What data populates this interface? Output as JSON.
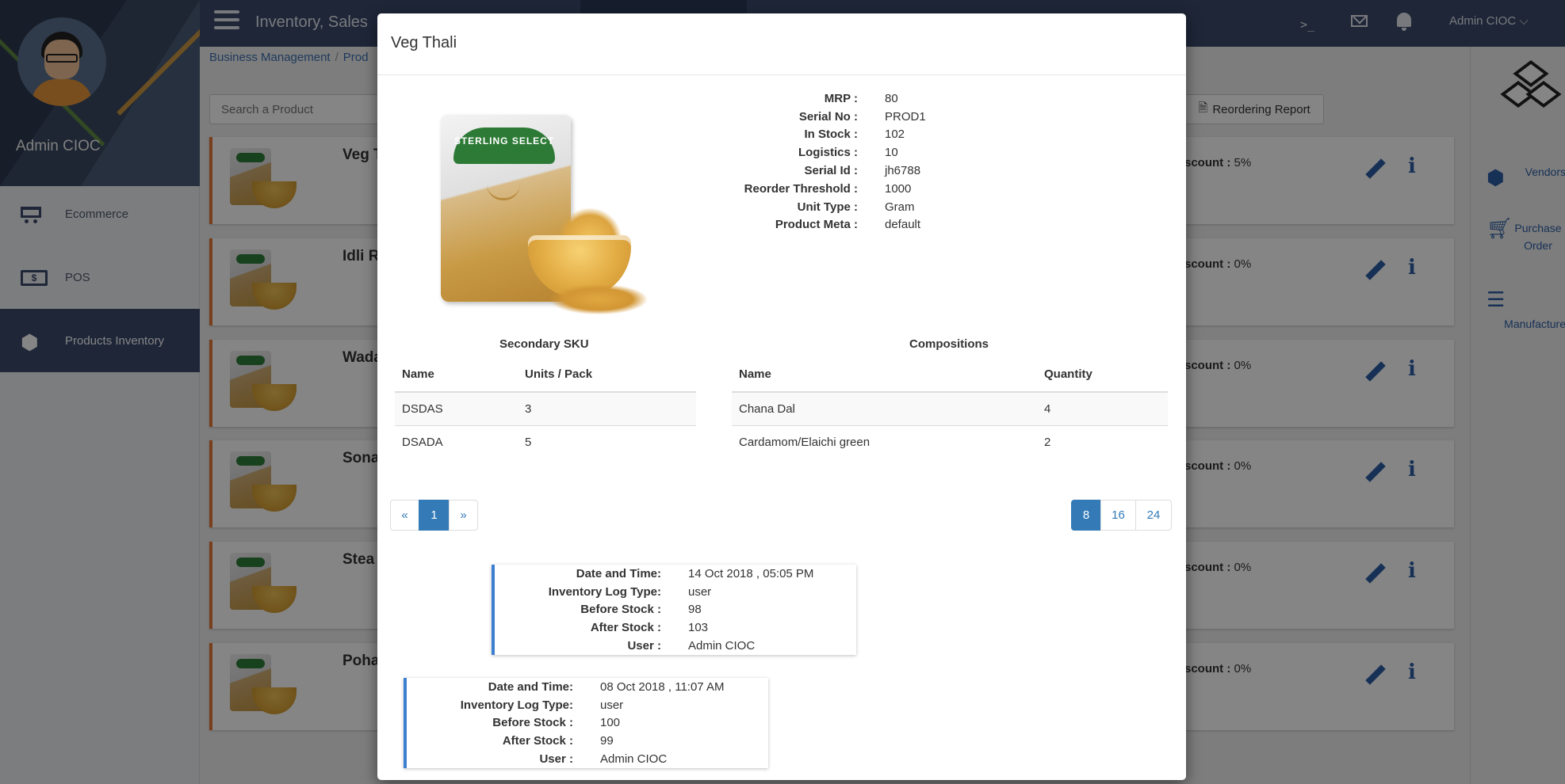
{
  "sidebar": {
    "profile_name": "Admin CIOC",
    "items": [
      {
        "label": "Ecommerce",
        "icon": "cart-icon"
      },
      {
        "label": "POS",
        "icon": "cash-icon"
      },
      {
        "label": "Products Inventory",
        "icon": "cubes-icon"
      }
    ]
  },
  "header": {
    "title": "Inventory, Sales",
    "user": "Admin CIOC",
    "terminal_glyph": ">_"
  },
  "breadcrumb": {
    "items": [
      "Business Management",
      "Prod"
    ]
  },
  "search": {
    "placeholder": "Search a Product"
  },
  "reorder_button": {
    "label": "Reordering Report"
  },
  "products": [
    {
      "name": "Veg T",
      "discount_label": "scount :",
      "discount": "5%"
    },
    {
      "name": "Idli R",
      "discount_label": "scount :",
      "discount": "0%"
    },
    {
      "name": "Wada",
      "discount_label": "scount :",
      "discount": "0%"
    },
    {
      "name": "Sona",
      "discount_label": "scount :",
      "discount": "0%"
    },
    {
      "name": "Stea",
      "discount_label": "scount :",
      "discount": "0%"
    },
    {
      "name": "Poha",
      "discount_label": "scount :",
      "discount": "0%"
    }
  ],
  "right_rail": {
    "items": [
      {
        "label": "Vendors",
        "icon": "vendors-icon"
      },
      {
        "label": "Purchase Order",
        "icon": "cart-icon"
      },
      {
        "label": "Manufacture",
        "icon": "list-icon"
      }
    ]
  },
  "modal": {
    "title": "Veg Thali",
    "product_image_text": "STERLING SELECT",
    "details": [
      {
        "label": "MRP :",
        "value": "80"
      },
      {
        "label": "Serial No :",
        "value": "PROD1"
      },
      {
        "label": "In Stock :",
        "value": "102"
      },
      {
        "label": "Logistics :",
        "value": "10"
      },
      {
        "label": "Serial Id :",
        "value": "jh6788"
      },
      {
        "label": "Reorder Threshold :",
        "value": "1000"
      },
      {
        "label": "Unit Type :",
        "value": "Gram"
      },
      {
        "label": "Product Meta :",
        "value": "default"
      }
    ],
    "secondary_sku": {
      "title": "Secondary SKU",
      "columns": [
        "Name",
        "Units / Pack"
      ],
      "rows": [
        [
          "DSDAS",
          "3"
        ],
        [
          "DSADA",
          "5"
        ]
      ]
    },
    "compositions": {
      "title": "Compositions",
      "columns": [
        "Name",
        "Quantity"
      ],
      "rows": [
        [
          "Chana Dal",
          "4"
        ],
        [
          "Cardamom/Elaichi green",
          "2"
        ]
      ]
    },
    "pagination": {
      "prev": "«",
      "current": "1",
      "next": "»"
    },
    "page_size": {
      "options": [
        "8",
        "16",
        "24"
      ],
      "selected": "8"
    },
    "logs": [
      {
        "fields": [
          {
            "label": "Date and Time:",
            "value": "14 Oct 2018 , 05:05 PM"
          },
          {
            "label": "Inventory Log Type:",
            "value": "user"
          },
          {
            "label": "Before Stock :",
            "value": "98"
          },
          {
            "label": "After Stock :",
            "value": "103"
          },
          {
            "label": "User :",
            "value": "Admin CIOC"
          }
        ]
      },
      {
        "fields": [
          {
            "label": "Date and Time:",
            "value": "08 Oct 2018 , 11:07 AM"
          },
          {
            "label": "Inventory Log Type:",
            "value": "user"
          },
          {
            "label": "Before Stock :",
            "value": "100"
          },
          {
            "label": "After Stock :",
            "value": "99"
          },
          {
            "label": "User :",
            "value": "Admin CIOC"
          }
        ]
      }
    ]
  }
}
